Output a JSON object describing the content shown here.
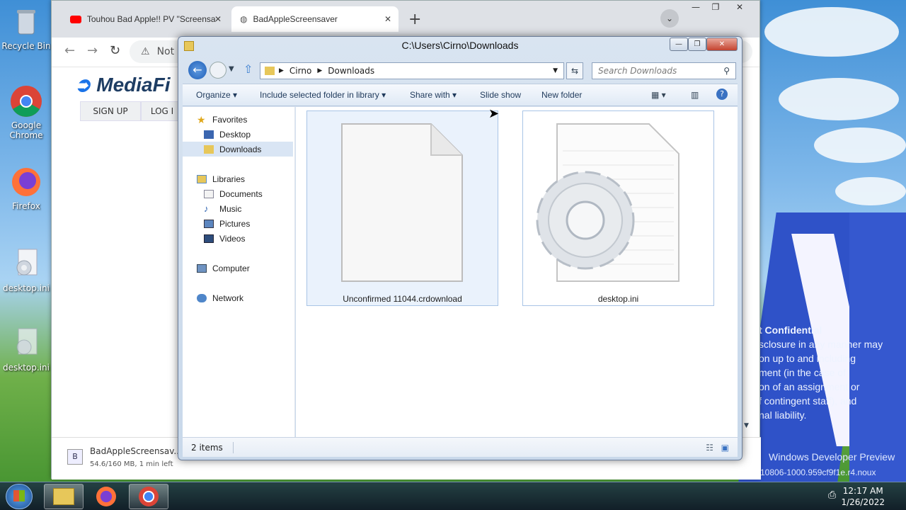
{
  "desktop": {
    "icons": [
      {
        "label": "Recycle Bin",
        "icon": "recycle-bin-icon"
      },
      {
        "label": "Google Chrome",
        "icon": "chrome-icon"
      },
      {
        "label": "Firefox",
        "icon": "firefox-icon"
      },
      {
        "label": "desktop.ini",
        "icon": "settings-file-icon"
      },
      {
        "label": "desktop.ini",
        "icon": "settings-file-icon"
      }
    ],
    "wallpaper_text": [
      "t Confidential",
      "sclosure in any manner may",
      "on up to and including",
      "ment (in the case of",
      "on of an assignment or",
      "f contingent staff), and",
      "nal liability."
    ],
    "watermark": [
      "Windows Developer Preview",
      "10806-1000.959cf9f1e.r4.noux"
    ]
  },
  "chrome": {
    "tabs": [
      {
        "title": "Touhou Bad Apple!! PV \"Screensa",
        "icon": "youtube-icon"
      },
      {
        "title": "BadAppleScreensaver",
        "icon": "globe-icon"
      }
    ],
    "omnibox": "Not s",
    "page": {
      "logo": "MediaFi",
      "signup": "SIGN UP",
      "login": "LOG I"
    },
    "download": {
      "filename": "BadAppleScreensav...",
      "progress": "54.6/160 MB, 1 min left"
    }
  },
  "explorer": {
    "title": "C:\\Users\\Cirno\\Downloads",
    "breadcrumb": [
      "Cirno",
      "Downloads"
    ],
    "search_placeholder": "Search Downloads",
    "commands": [
      "Organize",
      "Include selected folder in library",
      "Share with",
      "Slide show",
      "New folder"
    ],
    "nav": {
      "favorites": "Favorites",
      "favorites_items": [
        "Desktop",
        "Downloads"
      ],
      "libraries": "Libraries",
      "libraries_items": [
        "Documents",
        "Music",
        "Pictures",
        "Videos"
      ],
      "computer": "Computer",
      "network": "Network"
    },
    "files": [
      {
        "name": "Unconfirmed 11044.crdownload",
        "icon": "blank-file-icon"
      },
      {
        "name": "desktop.ini",
        "icon": "settings-file-icon"
      }
    ],
    "status": "2 items"
  },
  "taskbar": {
    "time": "12:17 AM",
    "date": "1/26/2022"
  },
  "colors": {
    "accent": "#2f52c8",
    "chrome_tabbar": "#dee1e6",
    "explorer_frame": "#c8d8ea"
  }
}
